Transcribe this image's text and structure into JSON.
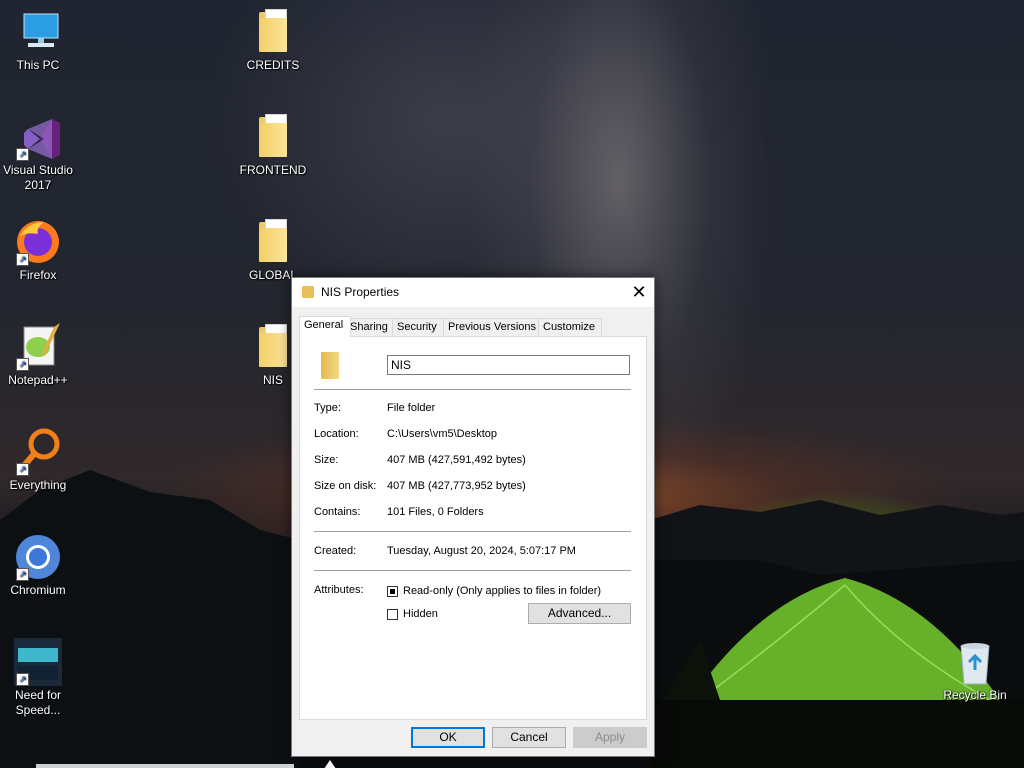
{
  "desktop": {
    "left_icons": [
      {
        "label": "This PC",
        "icon": "computer-icon"
      },
      {
        "label": "Visual Studio\n2017",
        "icon": "visual-studio-icon"
      },
      {
        "label": "Firefox",
        "icon": "firefox-icon"
      },
      {
        "label": "Notepad++",
        "icon": "notepad-plus-plus-icon"
      },
      {
        "label": "Everything",
        "icon": "everything-search-icon"
      },
      {
        "label": "Chromium",
        "icon": "chromium-icon"
      },
      {
        "label": "Need for\nSpeed...",
        "icon": "need-for-speed-icon"
      }
    ],
    "folder_icons": [
      {
        "label": "CREDITS",
        "icon": "folder-icon"
      },
      {
        "label": "FRONTEND",
        "icon": "folder-icon"
      },
      {
        "label": "GLOBAL",
        "icon": "folder-icon"
      },
      {
        "label": "NIS",
        "icon": "folder-icon"
      }
    ],
    "recycle_bin": {
      "label": "Recycle Bin",
      "icon": "recycle-bin-icon"
    }
  },
  "dialog": {
    "title": "NIS Properties",
    "close_glyph": "✕",
    "tabs": [
      "General",
      "Sharing",
      "Security",
      "Previous Versions",
      "Customize"
    ],
    "active_tab": "General",
    "name_value": "NIS",
    "type_label": "Type:",
    "type_value": "File folder",
    "location_label": "Location:",
    "location_value": "C:\\Users\\vm5\\Desktop",
    "size_label": "Size:",
    "size_value": "407 MB (427,591,492 bytes)",
    "size_on_disk_label": "Size on disk:",
    "size_on_disk_value": "407 MB (427,773,952 bytes)",
    "contains_label": "Contains:",
    "contains_value": "101 Files, 0 Folders",
    "created_label": "Created:",
    "created_value": "Tuesday, August 20, 2024, 5:07:17 PM",
    "attributes_label": "Attributes:",
    "readonly_label": "Read-only (Only applies to files in folder)",
    "hidden_label": "Hidden",
    "advanced_label": "Advanced...",
    "ok_label": "OK",
    "cancel_label": "Cancel",
    "apply_label": "Apply"
  },
  "colors": {
    "accent": "#0078d7",
    "folder": "#f3cf67"
  }
}
